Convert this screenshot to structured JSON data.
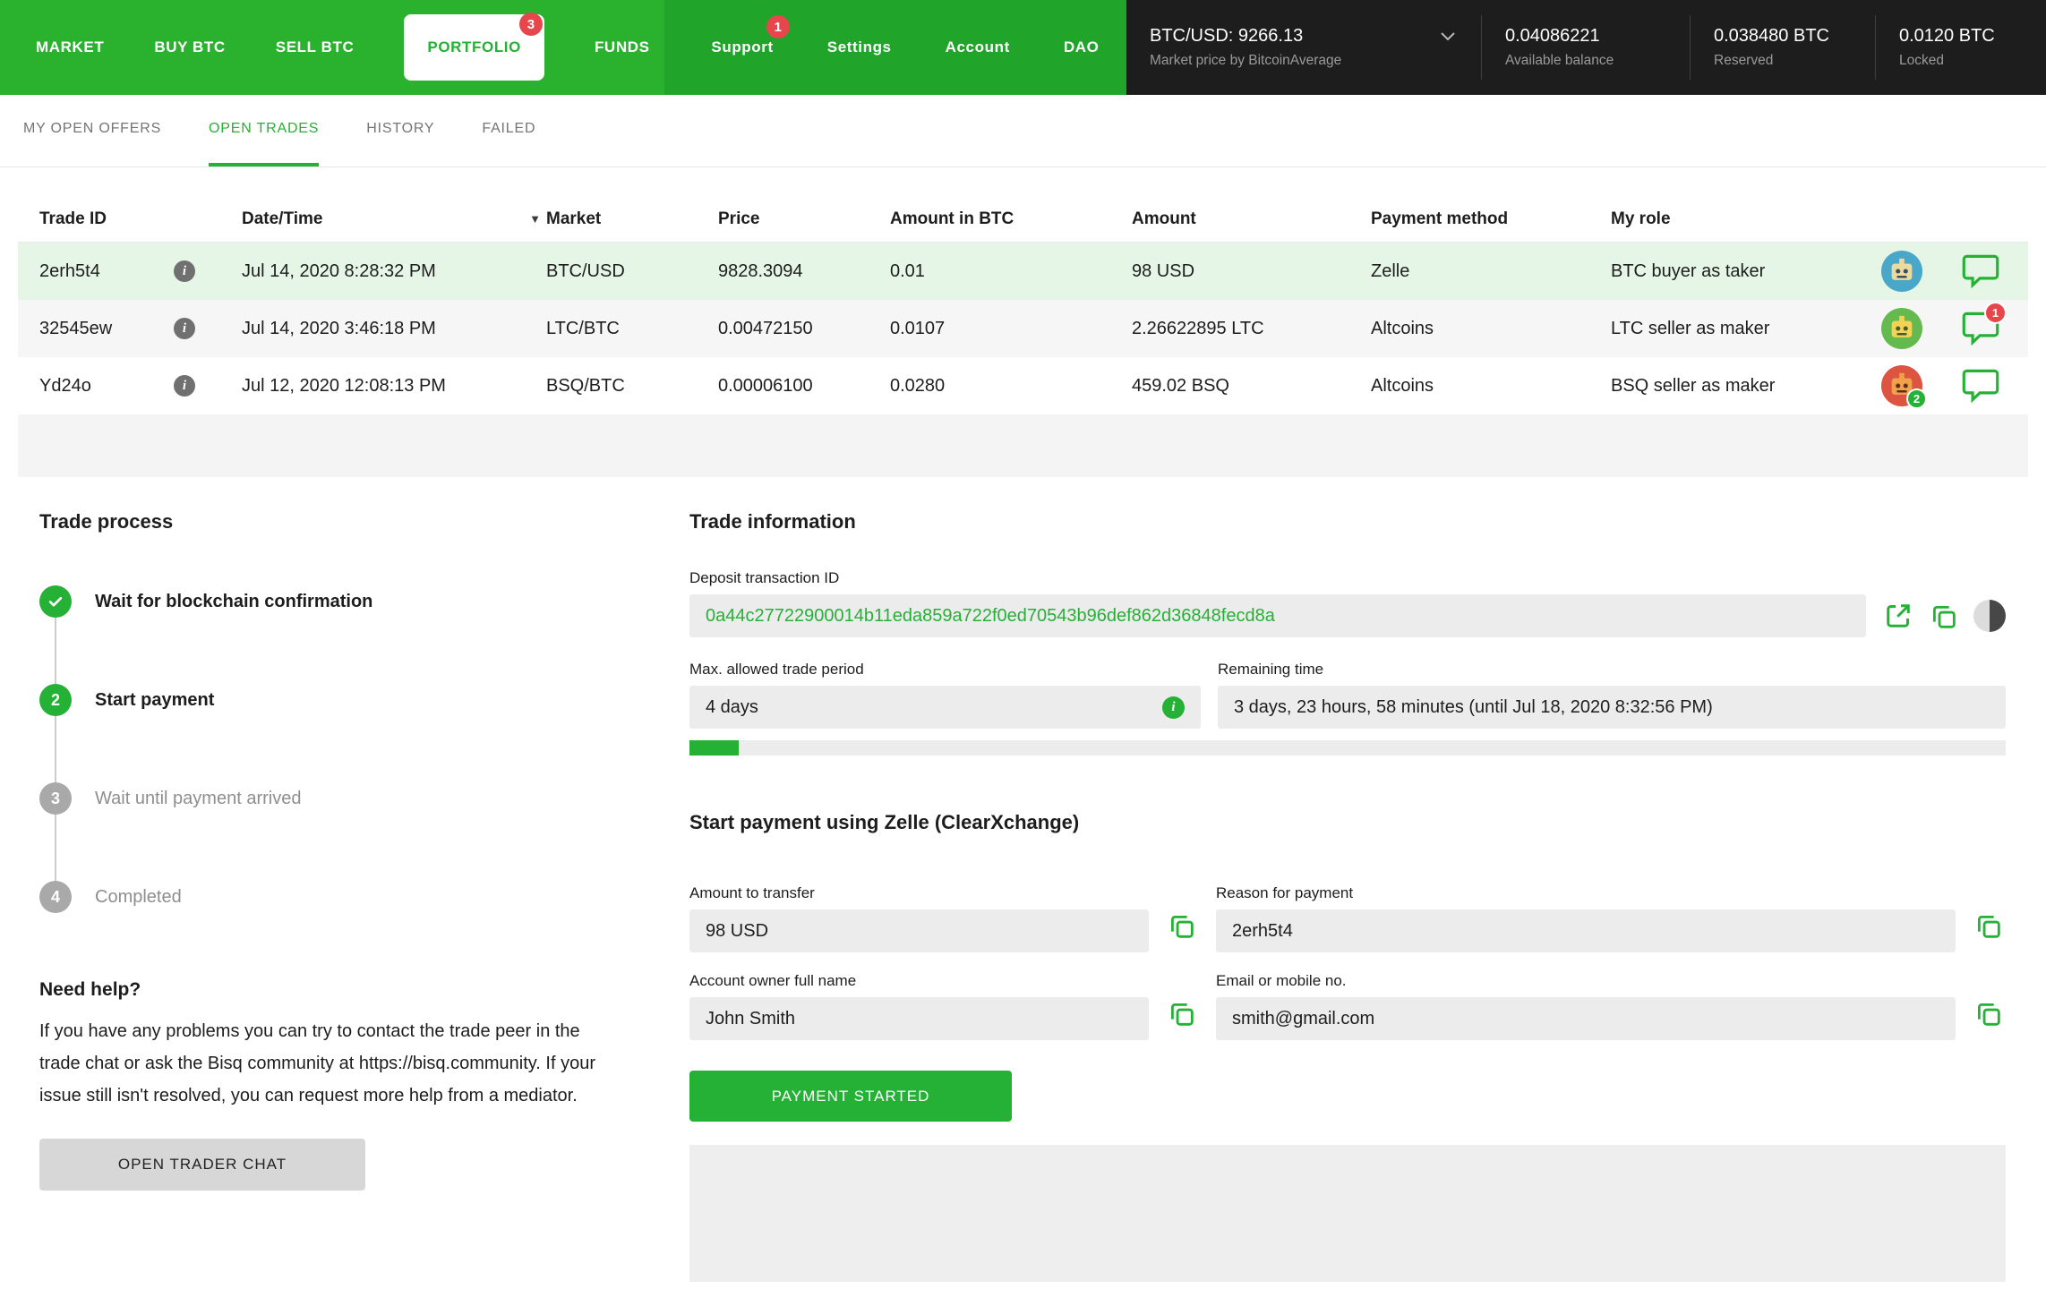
{
  "colors": {
    "accent_green": "#25b135",
    "badge_red": "#e8464d",
    "nav_green": "#2ab22f",
    "nav_green_dark": "#21a42a",
    "nav_dark_bg": "#1d1d1d",
    "selected_row_green": "#e6f6e6"
  },
  "nav": {
    "items": [
      {
        "label": "MARKET"
      },
      {
        "label": "BUY BTC"
      },
      {
        "label": "SELL BTC"
      },
      {
        "label": "PORTFOLIO",
        "badge": "3"
      },
      {
        "label": "FUNDS"
      }
    ],
    "secondary_items": [
      {
        "label": "Support",
        "badge": "1"
      },
      {
        "label": "Settings"
      },
      {
        "label": "Account"
      },
      {
        "label": "DAO"
      }
    ],
    "price": {
      "label": "BTC/USD: 9266.13",
      "subtitle": "Market price by BitcoinAverage"
    },
    "balances": [
      {
        "value": "0.04086221",
        "label": "Available balance"
      },
      {
        "value": "0.038480 BTC",
        "label": "Reserved"
      },
      {
        "value": "0.0120 BTC",
        "label": "Locked"
      }
    ]
  },
  "tabs": [
    {
      "label": "MY OPEN OFFERS"
    },
    {
      "label": "OPEN TRADES"
    },
    {
      "label": "HISTORY"
    },
    {
      "label": "FAILED"
    }
  ],
  "table": {
    "headers": {
      "trade_id": "Trade ID",
      "date": "Date/Time",
      "market": "Market",
      "price": "Price",
      "amount_btc": "Amount in BTC",
      "amount": "Amount",
      "payment": "Payment method",
      "role": "My role"
    },
    "rows": [
      {
        "trade_id": "2erh5t4",
        "date": "Jul 14, 2020 8:28:32 PM",
        "market": "BTC/USD",
        "price": "9828.3094",
        "amount_btc": "0.01",
        "amount": "98 USD",
        "payment": "Zelle",
        "role": "BTC buyer as taker",
        "selected": true
      },
      {
        "trade_id": "32545ew",
        "date": "Jul 14, 2020 3:46:18 PM",
        "market": "LTC/BTC",
        "price": "0.00472150",
        "amount_btc": "0.0107",
        "amount": "2.26622895 LTC",
        "payment": "Altcoins",
        "role": "LTC seller as maker",
        "chat_badge": "1"
      },
      {
        "trade_id": "Yd24o",
        "date": "Jul 12, 2020 12:08:13 PM",
        "market": "BSQ/BTC",
        "price": "0.00006100",
        "amount_btc": "0.0280",
        "amount": "459.02 BSQ",
        "payment": "Altcoins",
        "role": "BSQ seller as maker",
        "avatar_badge": "2"
      }
    ]
  },
  "trade_process": {
    "title": "Trade process",
    "steps": [
      {
        "label": "Wait for blockchain confirmation",
        "state": "done"
      },
      {
        "number": "2",
        "label": "Start payment",
        "state": "active"
      },
      {
        "number": "3",
        "label": "Wait until payment arrived",
        "state": "pending"
      },
      {
        "number": "4",
        "label": "Completed",
        "state": "pending"
      }
    ],
    "help_title": "Need help?",
    "help_text": "If you have any problems you can try to contact the trade peer in the trade chat or ask the Bisq community at https://bisq.community. If your issue still isn't resolved, you can request more help from a mediator.",
    "chat_button": "OPEN TRADER CHAT"
  },
  "trade_info": {
    "title": "Trade information",
    "deposit_label": "Deposit transaction ID",
    "deposit_tx": "0a44c27722900014b11eda859a722f0ed70543b96def862d36848fecd8a",
    "period_label": "Max. allowed trade period",
    "period_value": "4 days",
    "remaining_label": "Remaining time",
    "remaining_value": "3 days, 23 hours, 58 minutes (until Jul 18, 2020 8:32:56 PM)",
    "progress_style": "width:55px",
    "payment_title": "Start payment using Zelle (ClearXchange)",
    "fields": {
      "amount": {
        "label": "Amount to transfer",
        "value": "98 USD"
      },
      "reason": {
        "label": "Reason for payment",
        "value": "2erh5t4"
      },
      "owner": {
        "label": "Account owner full name",
        "value": "John Smith"
      },
      "email": {
        "label": "Email or mobile no.",
        "value": "smith@gmail.com"
      }
    },
    "payment_button": "PAYMENT STARTED"
  }
}
